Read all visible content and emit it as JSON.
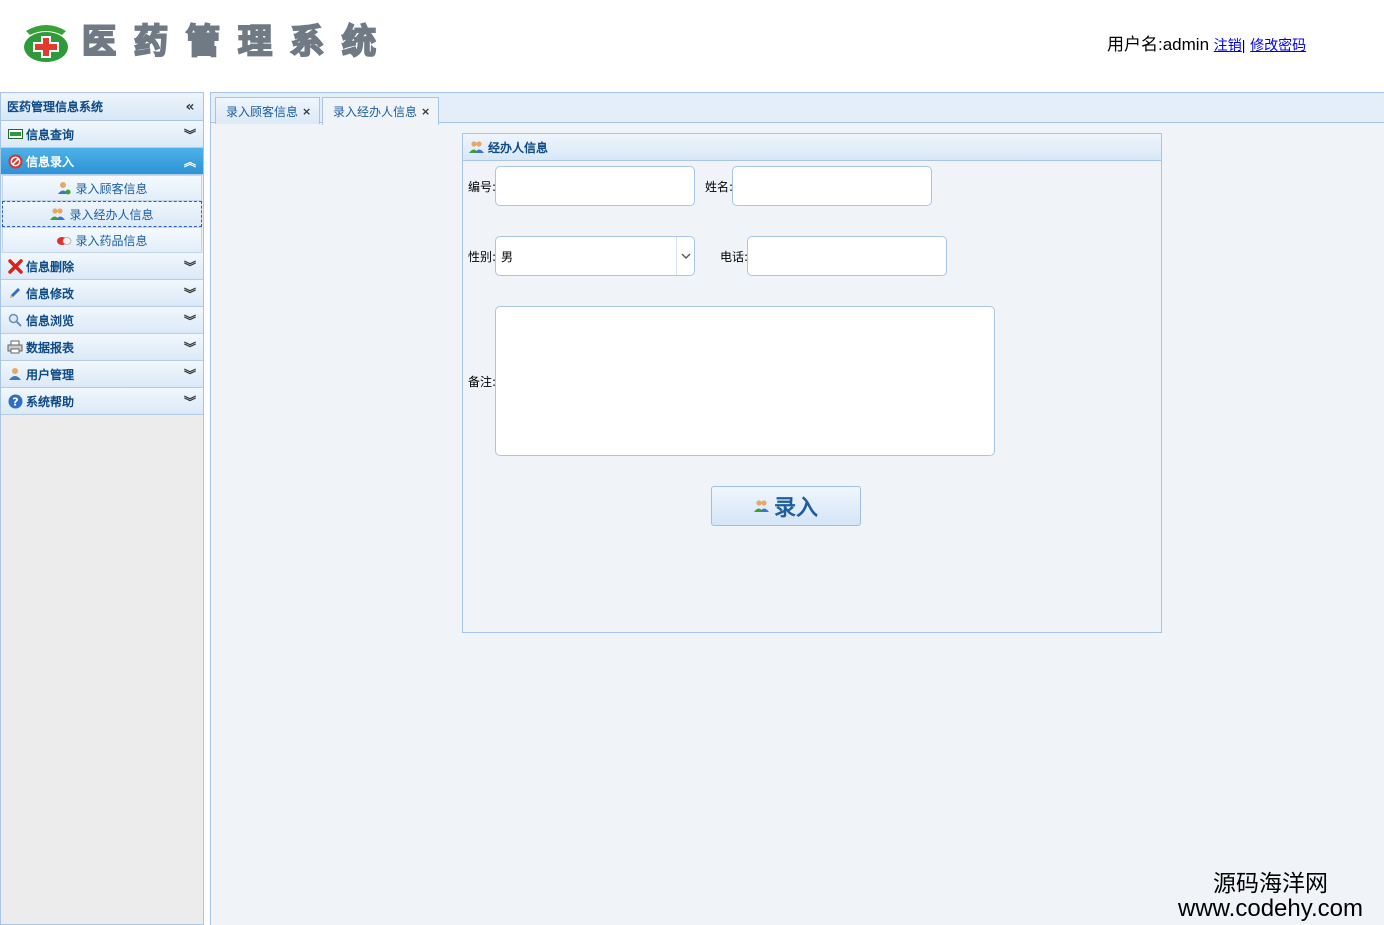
{
  "header": {
    "logo_chars": [
      "医",
      "药",
      "管",
      "理",
      "系",
      "统"
    ],
    "user_label": "用户名:admin",
    "logout_link": "注销",
    "separator": "|",
    "change_password_link": "修改密码"
  },
  "sidebar": {
    "title": "医药管理信息系统",
    "collapse_icon": "double-chevron-left-icon",
    "sections": [
      {
        "label": "信息查询",
        "icon": "monitor-icon",
        "expanded": false
      },
      {
        "label": "信息录入",
        "icon": "no-entry-icon",
        "expanded": true,
        "items": [
          {
            "label": "录入顾客信息",
            "icon": "user-icon"
          },
          {
            "label": "录入经办人信息",
            "icon": "users-icon",
            "selected": true
          },
          {
            "label": "录入药品信息",
            "icon": "pills-icon"
          }
        ]
      },
      {
        "label": "信息删除",
        "icon": "red-x-icon",
        "expanded": false
      },
      {
        "label": "信息修改",
        "icon": "pencil-icon",
        "expanded": false
      },
      {
        "label": "信息浏览",
        "icon": "magnifier-icon",
        "expanded": false
      },
      {
        "label": "数据报表",
        "icon": "printer-icon",
        "expanded": false
      },
      {
        "label": "用户管理",
        "icon": "user-icon",
        "expanded": false
      },
      {
        "label": "系统帮助",
        "icon": "help-icon",
        "expanded": false
      }
    ]
  },
  "tabs": [
    {
      "label": "录入顾客信息",
      "active": false
    },
    {
      "label": "录入经办人信息",
      "active": true
    }
  ],
  "form": {
    "panel_title": "经办人信息",
    "id_label": "编号:",
    "id_value": "",
    "name_label": "姓名:",
    "name_value": "",
    "gender_label": "性别:",
    "gender_value": "男",
    "phone_label": "电话:",
    "phone_value": "",
    "remark_label": "备注:",
    "remark_value": "",
    "submit_label": "录入"
  },
  "watermark": {
    "line1": "源码海洋网",
    "line2": "www.codehy.com"
  },
  "colors": {
    "accent": "#2d93d6",
    "border": "#a8c6e4",
    "link": "#0000ee",
    "nav_text": "#0e4b84"
  }
}
